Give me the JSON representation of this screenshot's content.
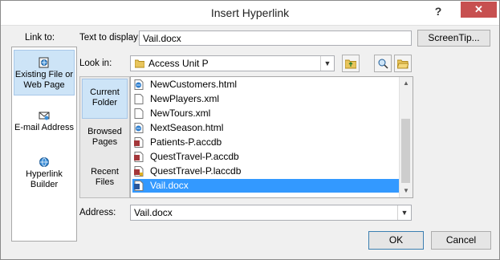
{
  "dialog": {
    "title": "Insert Hyperlink",
    "help": "?",
    "close": "✕"
  },
  "link_to": {
    "label": "Link to:",
    "items": [
      {
        "label": "Existing File or Web Page",
        "icon": "web-page-icon",
        "selected": true
      },
      {
        "label": "E-mail Address",
        "icon": "email-icon",
        "selected": false
      },
      {
        "label": "Hyperlink Builder",
        "icon": "hyperlink-builder-icon",
        "selected": false
      }
    ]
  },
  "text_to_display": {
    "label": "Text to display:",
    "value": "Vail.docx"
  },
  "screentip_label": "ScreenTip...",
  "look_in": {
    "label": "Look in:",
    "value": "Access Unit P"
  },
  "nav": {
    "items": [
      {
        "label": "Current Folder",
        "selected": true
      },
      {
        "label": "Browsed Pages",
        "selected": false
      },
      {
        "label": "Recent Files",
        "selected": false
      }
    ]
  },
  "files": [
    {
      "name": "NewCustomers.html",
      "icon": "html-file-icon",
      "selected": false
    },
    {
      "name": "NewPlayers.xml",
      "icon": "xml-file-icon",
      "selected": false
    },
    {
      "name": "NewTours.xml",
      "icon": "xml-file-icon",
      "selected": false
    },
    {
      "name": "NextSeason.html",
      "icon": "html-file-icon",
      "selected": false
    },
    {
      "name": "Patients-P.accdb",
      "icon": "access-file-icon",
      "selected": false
    },
    {
      "name": "QuestTravel-P.accdb",
      "icon": "access-file-icon",
      "selected": false
    },
    {
      "name": "QuestTravel-P.laccdb",
      "icon": "access-lock-file-icon",
      "selected": false
    },
    {
      "name": "Vail.docx",
      "icon": "word-file-icon",
      "selected": true
    }
  ],
  "address": {
    "label": "Address:",
    "value": "Vail.docx"
  },
  "buttons": {
    "ok": "OK",
    "cancel": "Cancel"
  },
  "colors": {
    "selection": "#3399ff",
    "close": "#c75050"
  }
}
